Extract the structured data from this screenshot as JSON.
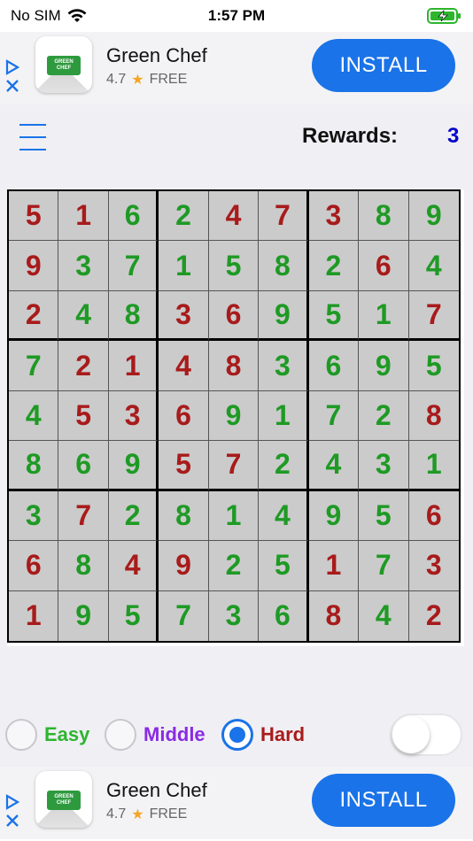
{
  "status_bar": {
    "carrier": "No SIM",
    "time": "1:57 PM",
    "icons": [
      "wifi-icon",
      "battery-charging-icon"
    ]
  },
  "ad_top": {
    "title": "Green Chef",
    "rating": "4.7",
    "price": "FREE",
    "install_label": "INSTALL",
    "logo_text": "GREEN CHEF"
  },
  "ad_bottom": {
    "title": "Green Chef",
    "rating": "4.7",
    "price": "FREE",
    "install_label": "INSTALL",
    "logo_text": "GREEN CHEF"
  },
  "header": {
    "rewards_label": "Rewards:",
    "rewards_value": "3"
  },
  "board": {
    "rows": [
      [
        5,
        1,
        6,
        2,
        4,
        7,
        3,
        8,
        9
      ],
      [
        9,
        3,
        7,
        1,
        5,
        8,
        2,
        6,
        4
      ],
      [
        2,
        4,
        8,
        3,
        6,
        9,
        5,
        1,
        7
      ],
      [
        7,
        2,
        1,
        4,
        8,
        3,
        6,
        9,
        5
      ],
      [
        4,
        5,
        3,
        6,
        9,
        1,
        7,
        2,
        8
      ],
      [
        8,
        6,
        9,
        5,
        7,
        2,
        4,
        3,
        1
      ],
      [
        3,
        7,
        2,
        8,
        1,
        4,
        9,
        5,
        6
      ],
      [
        6,
        8,
        4,
        9,
        2,
        5,
        1,
        7,
        3
      ],
      [
        1,
        9,
        5,
        7,
        3,
        6,
        8,
        4,
        2
      ]
    ],
    "cell_types": [
      [
        "g",
        "g",
        "u",
        "u",
        "g",
        "g",
        "g",
        "u",
        "u"
      ],
      [
        "g",
        "u",
        "u",
        "u",
        "u",
        "u",
        "u",
        "g",
        "u"
      ],
      [
        "g",
        "u",
        "u",
        "g",
        "g",
        "u",
        "u",
        "u",
        "g"
      ],
      [
        "u",
        "g",
        "g",
        "g",
        "g",
        "u",
        "u",
        "u",
        "u"
      ],
      [
        "u",
        "g",
        "g",
        "g",
        "u",
        "u",
        "u",
        "u",
        "g"
      ],
      [
        "u",
        "u",
        "u",
        "g",
        "g",
        "u",
        "u",
        "u",
        "u"
      ],
      [
        "u",
        "g",
        "u",
        "u",
        "u",
        "u",
        "u",
        "u",
        "g"
      ],
      [
        "g",
        "u",
        "g",
        "g",
        "u",
        "u",
        "g",
        "u",
        "g"
      ],
      [
        "g",
        "u",
        "u",
        "u",
        "u",
        "u",
        "g",
        "u",
        "g"
      ]
    ],
    "colors": {
      "given": "#a81b1b",
      "user": "#1e9a24"
    }
  },
  "difficulty": {
    "options": [
      {
        "label": "Easy",
        "selected": false
      },
      {
        "label": "Middle",
        "selected": false
      },
      {
        "label": "Hard",
        "selected": true
      }
    ]
  },
  "toggle": {
    "on": false
  }
}
